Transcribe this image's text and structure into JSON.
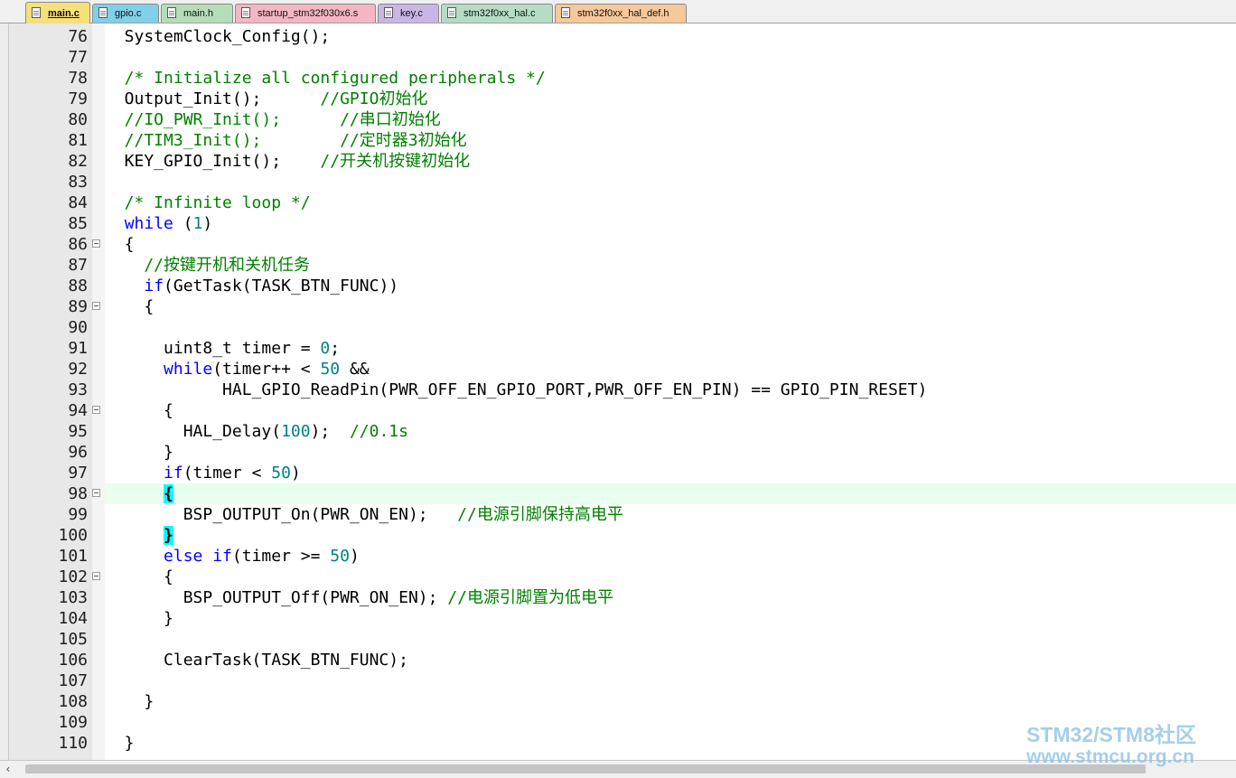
{
  "tabs": [
    {
      "label": "main.c",
      "active": true,
      "color": "#f5e07a"
    },
    {
      "label": "gpio.c",
      "active": false,
      "color": "#7fd0e8"
    },
    {
      "label": "main.h",
      "active": false,
      "color": "#b5ddb8"
    },
    {
      "label": "startup_stm32f030x6.s",
      "active": false,
      "color": "#f4b6c4"
    },
    {
      "label": "key.c",
      "active": false,
      "color": "#c9b6e6"
    },
    {
      "label": "stm32f0xx_hal.c",
      "active": false,
      "color": "#b5ddc4"
    },
    {
      "label": "stm32f0xx_hal_def.h",
      "active": false,
      "color": "#f7c89a"
    }
  ],
  "editor": {
    "current_line": "98",
    "lines": [
      {
        "n": "76",
        "fold": false,
        "segs": [
          [
            "",
            "  SystemClock_Config();"
          ]
        ]
      },
      {
        "n": "77",
        "fold": false,
        "segs": []
      },
      {
        "n": "78",
        "fold": false,
        "segs": [
          [
            "cm",
            "  /* Initialize all configured peripherals */"
          ]
        ]
      },
      {
        "n": "79",
        "fold": false,
        "segs": [
          [
            "",
            "  Output_Init();      "
          ],
          [
            "cm",
            "//GPIO初始化"
          ]
        ]
      },
      {
        "n": "80",
        "fold": false,
        "segs": [
          [
            "cm",
            "  //IO_PWR_Init();      //串口初始化"
          ]
        ]
      },
      {
        "n": "81",
        "fold": false,
        "segs": [
          [
            "cm",
            "  //TIM3_Init();        //定时器3初始化"
          ]
        ]
      },
      {
        "n": "82",
        "fold": false,
        "segs": [
          [
            "",
            "  KEY_GPIO_Init();    "
          ],
          [
            "cm",
            "//开关机按键初始化"
          ]
        ]
      },
      {
        "n": "83",
        "fold": false,
        "segs": []
      },
      {
        "n": "84",
        "fold": false,
        "segs": [
          [
            "cm",
            "  /* Infinite loop */"
          ]
        ]
      },
      {
        "n": "85",
        "fold": false,
        "segs": [
          [
            "",
            "  "
          ],
          [
            "kw",
            "while"
          ],
          [
            "",
            " ("
          ],
          [
            "num",
            "1"
          ],
          [
            "",
            ")"
          ]
        ]
      },
      {
        "n": "86",
        "fold": true,
        "segs": [
          [
            "",
            "  {"
          ]
        ]
      },
      {
        "n": "87",
        "fold": false,
        "segs": [
          [
            "cm",
            "    //按键开机和关机任务"
          ]
        ]
      },
      {
        "n": "88",
        "fold": false,
        "segs": [
          [
            "",
            "    "
          ],
          [
            "kw",
            "if"
          ],
          [
            "",
            "(GetTask(TASK_BTN_FUNC))"
          ]
        ]
      },
      {
        "n": "89",
        "fold": true,
        "segs": [
          [
            "",
            "    {"
          ]
        ]
      },
      {
        "n": "90",
        "fold": false,
        "segs": []
      },
      {
        "n": "91",
        "fold": false,
        "segs": [
          [
            "",
            "      uint8_t timer = "
          ],
          [
            "num",
            "0"
          ],
          [
            "",
            ";"
          ]
        ]
      },
      {
        "n": "92",
        "fold": false,
        "segs": [
          [
            "",
            "      "
          ],
          [
            "kw",
            "while"
          ],
          [
            "",
            "(timer++ < "
          ],
          [
            "num",
            "50"
          ],
          [
            "",
            " &&"
          ]
        ]
      },
      {
        "n": "93",
        "fold": false,
        "segs": [
          [
            "",
            "            HAL_GPIO_ReadPin(PWR_OFF_EN_GPIO_PORT,PWR_OFF_EN_PIN) == GPIO_PIN_RESET)"
          ]
        ]
      },
      {
        "n": "94",
        "fold": true,
        "segs": [
          [
            "",
            "      {"
          ]
        ]
      },
      {
        "n": "95",
        "fold": false,
        "segs": [
          [
            "",
            "        HAL_Delay("
          ],
          [
            "num",
            "100"
          ],
          [
            "",
            ");  "
          ],
          [
            "cm",
            "//0.1s"
          ]
        ]
      },
      {
        "n": "96",
        "fold": false,
        "segs": [
          [
            "",
            "      }"
          ]
        ]
      },
      {
        "n": "97",
        "fold": false,
        "segs": [
          [
            "",
            "      "
          ],
          [
            "kw",
            "if"
          ],
          [
            "",
            "(timer < "
          ],
          [
            "num",
            "50"
          ],
          [
            "",
            ")"
          ]
        ]
      },
      {
        "n": "98",
        "fold": true,
        "segs": [
          [
            "",
            "      "
          ],
          [
            "brace-hl",
            "{"
          ]
        ]
      },
      {
        "n": "99",
        "fold": false,
        "segs": [
          [
            "",
            "        BSP_OUTPUT_On(PWR_ON_EN);   "
          ],
          [
            "cm",
            "//电源引脚保持高电平"
          ]
        ]
      },
      {
        "n": "100",
        "fold": false,
        "segs": [
          [
            "",
            "      "
          ],
          [
            "brace-hl",
            "}"
          ]
        ]
      },
      {
        "n": "101",
        "fold": false,
        "segs": [
          [
            "",
            "      "
          ],
          [
            "kw",
            "else if"
          ],
          [
            "",
            "(timer >= "
          ],
          [
            "num",
            "50"
          ],
          [
            "",
            ")"
          ]
        ]
      },
      {
        "n": "102",
        "fold": true,
        "segs": [
          [
            "",
            "      {"
          ]
        ]
      },
      {
        "n": "103",
        "fold": false,
        "segs": [
          [
            "",
            "        BSP_OUTPUT_Off(PWR_ON_EN); "
          ],
          [
            "cm",
            "//电源引脚置为低电平"
          ]
        ]
      },
      {
        "n": "104",
        "fold": false,
        "segs": [
          [
            "",
            "      }"
          ]
        ]
      },
      {
        "n": "105",
        "fold": false,
        "segs": []
      },
      {
        "n": "106",
        "fold": false,
        "segs": [
          [
            "",
            "      ClearTask(TASK_BTN_FUNC);"
          ]
        ]
      },
      {
        "n": "107",
        "fold": false,
        "segs": []
      },
      {
        "n": "108",
        "fold": false,
        "segs": [
          [
            "",
            "    }"
          ]
        ]
      },
      {
        "n": "109",
        "fold": false,
        "segs": []
      },
      {
        "n": "110",
        "fold": false,
        "segs": [
          [
            "",
            "  }"
          ]
        ]
      }
    ]
  },
  "scrollbar": {
    "left_arrow": "‹"
  },
  "watermark": {
    "brand": "STM32/STM8社区",
    "url": "www.stmcu.org.cn"
  }
}
